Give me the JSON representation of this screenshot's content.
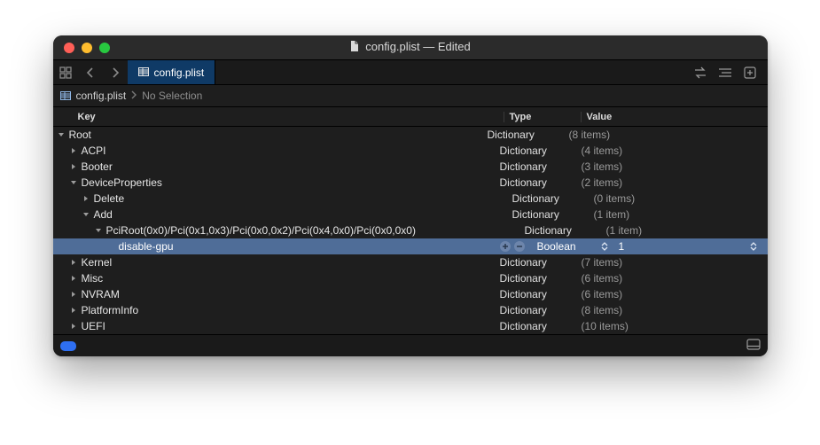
{
  "window": {
    "title": "config.plist — Edited"
  },
  "tab": {
    "label": "config.plist"
  },
  "breadcrumb": {
    "file": "config.plist",
    "selection": "No Selection"
  },
  "columns": {
    "key": "Key",
    "type": "Type",
    "value": "Value"
  },
  "rows": [
    {
      "indent": 0,
      "disc": "down",
      "key": "Root",
      "type": "Dictionary",
      "value": "(8 items)",
      "selected": false
    },
    {
      "indent": 1,
      "disc": "right",
      "key": "ACPI",
      "type": "Dictionary",
      "value": "(4 items)",
      "selected": false
    },
    {
      "indent": 1,
      "disc": "right",
      "key": "Booter",
      "type": "Dictionary",
      "value": "(3 items)",
      "selected": false
    },
    {
      "indent": 1,
      "disc": "down",
      "key": "DeviceProperties",
      "type": "Dictionary",
      "value": "(2 items)",
      "selected": false
    },
    {
      "indent": 2,
      "disc": "right",
      "key": "Delete",
      "type": "Dictionary",
      "value": "(0 items)",
      "selected": false
    },
    {
      "indent": 2,
      "disc": "down",
      "key": "Add",
      "type": "Dictionary",
      "value": "(1 item)",
      "selected": false
    },
    {
      "indent": 3,
      "disc": "down",
      "key": "PciRoot(0x0)/Pci(0x1,0x3)/Pci(0x0,0x2)/Pci(0x4,0x0)/Pci(0x0,0x0)",
      "type": "Dictionary",
      "value": "(1 item)",
      "selected": false
    },
    {
      "indent": 4,
      "disc": "none",
      "key": "disable-gpu",
      "type": "Boolean",
      "value": "1",
      "selected": true,
      "typeStepper": true,
      "valStepper": true,
      "plusminus": true
    },
    {
      "indent": 1,
      "disc": "right",
      "key": "Kernel",
      "type": "Dictionary",
      "value": "(7 items)",
      "selected": false
    },
    {
      "indent": 1,
      "disc": "right",
      "key": "Misc",
      "type": "Dictionary",
      "value": "(6 items)",
      "selected": false
    },
    {
      "indent": 1,
      "disc": "right",
      "key": "NVRAM",
      "type": "Dictionary",
      "value": "(6 items)",
      "selected": false
    },
    {
      "indent": 1,
      "disc": "right",
      "key": "PlatformInfo",
      "type": "Dictionary",
      "value": "(8 items)",
      "selected": false
    },
    {
      "indent": 1,
      "disc": "right",
      "key": "UEFI",
      "type": "Dictionary",
      "value": "(10 items)",
      "selected": false
    }
  ]
}
